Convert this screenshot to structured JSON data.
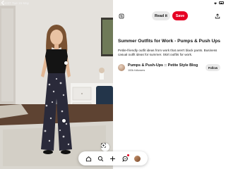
{
  "status_bar": {
    "time": "14:07",
    "date": "Tue 15 May"
  },
  "pin": {
    "title": "Summer Outfits for Work - Pumps & Push Ups",
    "description": "Petite-friendly outfit ideas from work that aren't black pants. Business casual outfit ideas for summer. Skirt outfits for work."
  },
  "actions": {
    "read_label": "Read it",
    "save_label": "Save"
  },
  "creator": {
    "name": "Pumps & Push-Ups :: Petite Style Blog",
    "followers": "100k followers",
    "follow_label": "Follow"
  },
  "colors": {
    "save": "#e60023",
    "chip": "#e9e9e9"
  },
  "icons": [
    "back-chevron-icon",
    "tune-icon",
    "share-icon",
    "lens-search-icon",
    "home-icon",
    "search-icon",
    "plus-icon",
    "chat-icon",
    "profile-avatar"
  ]
}
